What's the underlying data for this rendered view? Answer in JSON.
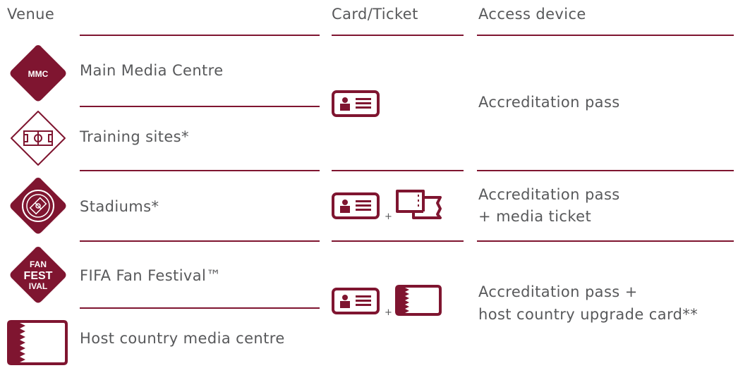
{
  "headers": {
    "venue": "Venue",
    "card": "Card/Ticket",
    "access": "Access device"
  },
  "venues": [
    {
      "name": "Main Media Centre",
      "badge": "MMC"
    },
    {
      "name": "Training sites*"
    },
    {
      "name": "Stadiums*"
    },
    {
      "name": "FIFA Fan Festival™",
      "badge_top": "FAN",
      "badge_mid": "FEST",
      "badge_bot": "IVAL"
    },
    {
      "name": "Host country media centre"
    }
  ],
  "access": {
    "group1": "Accreditation pass",
    "group2_line1": "Accreditation pass",
    "group2_line2": "+ media ticket",
    "group3_line1": "Accreditation pass  +",
    "group3_line2": "host country upgrade card**"
  },
  "plus": "+",
  "colors": {
    "maroon": "#7f1530",
    "text": "#58595b",
    "line": "#7f1530"
  }
}
